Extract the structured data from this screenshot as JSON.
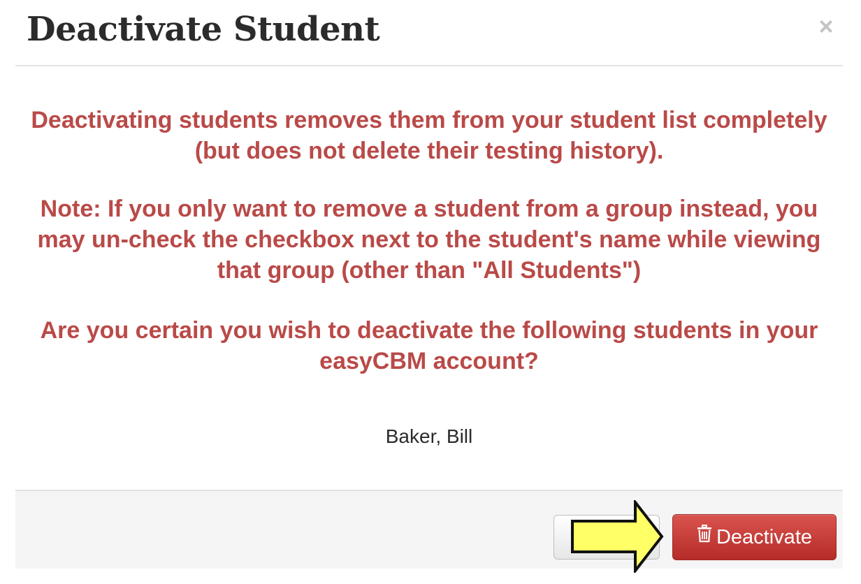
{
  "header": {
    "title": "Deactivate Student",
    "close_label": "×"
  },
  "body": {
    "paragraphs": [
      "Deactivating students removes them from your student list completely (but does not delete their testing history).",
      "Note: If you only want to remove a student from a group instead, you may un-check the checkbox next to the student's name while viewing that group (other than \"All Students\")",
      "Are you certain you wish to deactivate the following students in your easyCBM account?"
    ],
    "students": [
      "Baker, Bill"
    ]
  },
  "footer": {
    "cancel_label": "",
    "deactivate_label": "Deactivate",
    "deactivate_icon": "trash-icon"
  },
  "colors": {
    "warning_text": "#b94a48",
    "danger_button": "#c9302c",
    "annotation_arrow": "#ffff66"
  }
}
